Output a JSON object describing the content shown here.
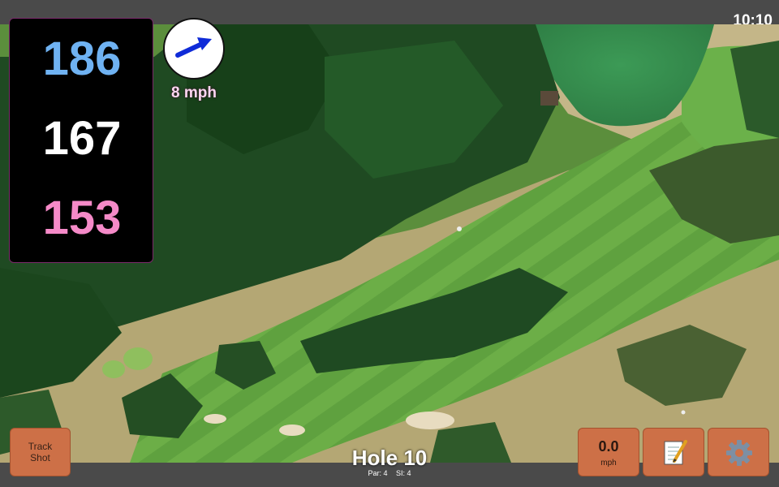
{
  "status": {
    "clock": "10:10"
  },
  "yardages": {
    "back": "186",
    "middle": "167",
    "front": "153"
  },
  "wind": {
    "speed": "8 mph",
    "icon": "wind-arrow-icon"
  },
  "hole": {
    "title": "Hole 10",
    "par": "Par: 4",
    "stroke_index": "SI: 4"
  },
  "buttons": {
    "track_shot_line1": "Track",
    "track_shot_line2": "Shot",
    "speed_value": "0.0",
    "speed_unit": "mph",
    "notes_icon": "notepad-icon",
    "settings_icon": "gear-icon"
  },
  "colors": {
    "back": "#6fb2f2",
    "middle": "#ffffff",
    "front": "#f58ac8",
    "button": "#cd7047"
  }
}
